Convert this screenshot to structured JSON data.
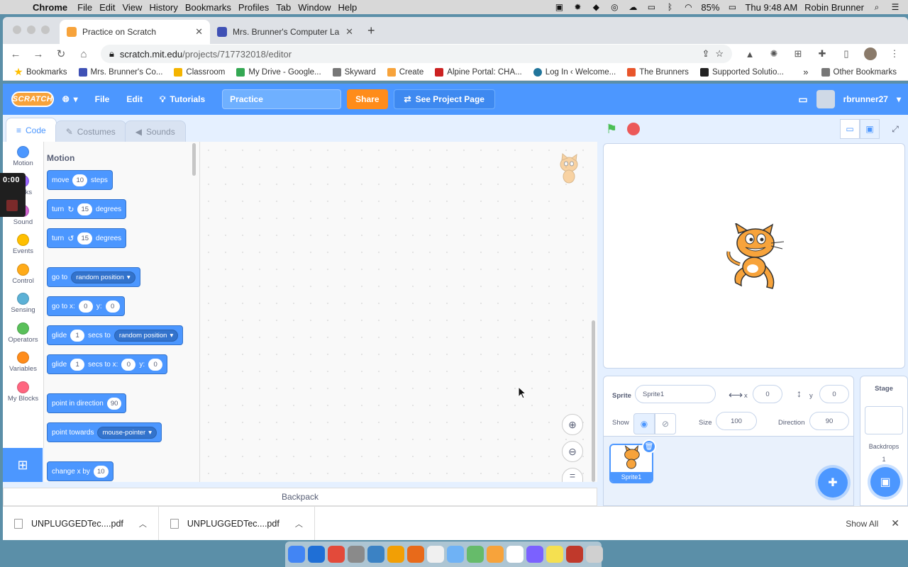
{
  "menubar": {
    "app": "Chrome",
    "items": [
      "File",
      "Edit",
      "View",
      "History",
      "Bookmarks",
      "Profiles",
      "Tab",
      "Window",
      "Help"
    ],
    "battery": "85%",
    "clock": "Thu 9:48 AM",
    "user": "Robin Brunner"
  },
  "tabs": [
    {
      "title": "Practice on Scratch",
      "color": "#f7a33b"
    },
    {
      "title": "Mrs. Brunner's Computer Lab",
      "color": "#3f51b5"
    }
  ],
  "omnibox": {
    "host": "scratch.mit.edu",
    "path": "/projects/717732018/editor"
  },
  "bookmarks": [
    {
      "label": "Bookmarks",
      "color": "#ffffff"
    },
    {
      "label": "Mrs. Brunner's Co...",
      "color": "#3f51b5"
    },
    {
      "label": "Classroom",
      "color": "#f4b400"
    },
    {
      "label": "My Drive - Google...",
      "color": "#34a853"
    },
    {
      "label": "Skyward",
      "color": "#777777"
    },
    {
      "label": "Create",
      "color": "#f7a33b"
    },
    {
      "label": "Alpine Portal: CHA...",
      "color": "#cc2222"
    },
    {
      "label": "Log In ‹ Welcome...",
      "color": "#21759b"
    },
    {
      "label": "The Brunners",
      "color": "#e8552b"
    },
    {
      "label": "Supported Solutio...",
      "color": "#222222"
    }
  ],
  "bookmarks_more": "»",
  "bookmarks_other": "Other Bookmarks",
  "scratch": {
    "logo": "SCRATCH",
    "file": "File",
    "edit": "Edit",
    "tutorials": "Tutorials",
    "project_title": "Practice",
    "share": "Share",
    "see_project": "See Project Page",
    "username": "rbrunner27",
    "tabs": [
      "Code",
      "Costumes",
      "Sounds"
    ],
    "categories": [
      {
        "label": "Motion",
        "color": "#4c97ff"
      },
      {
        "label": "Looks",
        "color": "#9966ff"
      },
      {
        "label": "Sound",
        "color": "#cf63cf"
      },
      {
        "label": "Events",
        "color": "#ffbf00"
      },
      {
        "label": "Control",
        "color": "#ffab19"
      },
      {
        "label": "Sensing",
        "color": "#5cb1d6"
      },
      {
        "label": "Operators",
        "color": "#59c059"
      },
      {
        "label": "Variables",
        "color": "#ff8c1a"
      },
      {
        "label": "My Blocks",
        "color": "#ff6680"
      }
    ],
    "palette_heading": "Motion",
    "blocks": {
      "move": {
        "a": "move",
        "v": "10",
        "b": "steps"
      },
      "turn_right": {
        "a": "turn",
        "v": "15",
        "b": "degrees"
      },
      "turn_left": {
        "a": "turn",
        "v": "15",
        "b": "degrees"
      },
      "goto": {
        "a": "go to",
        "dd": "random position"
      },
      "goto_xy": {
        "a": "go to x:",
        "x": "0",
        "b": "y:",
        "y": "0"
      },
      "glide": {
        "a": "glide",
        "v": "1",
        "b": "secs to",
        "dd": "random position"
      },
      "glide_xy": {
        "a": "glide",
        "v": "1",
        "b": "secs to x:",
        "x": "0",
        "c": "y:",
        "y": "0"
      },
      "point_dir": {
        "a": "point in direction",
        "v": "90"
      },
      "point_towards": {
        "a": "point towards",
        "dd": "mouse-pointer"
      },
      "change_x": {
        "a": "change x by",
        "v": "10"
      }
    },
    "backpack": "Backpack",
    "sprite_info": {
      "sprite_label": "Sprite",
      "sprite_name": "Sprite1",
      "x_label": "x",
      "x": "0",
      "y_label": "y",
      "y": "0",
      "show_label": "Show",
      "size_label": "Size",
      "size": "100",
      "direction_label": "Direction",
      "direction": "90"
    },
    "sprite_thumb": "Sprite1",
    "stage_panel": {
      "title": "Stage",
      "backdrops_label": "Backdrops",
      "backdrops_count": "1"
    }
  },
  "recorder_time": "0:00",
  "downloads": [
    {
      "name": "UNPLUGGEDTec....pdf"
    },
    {
      "name": "UNPLUGGEDTec....pdf"
    }
  ],
  "downloads_show_all": "Show All",
  "dock_colors": [
    "#4285f4",
    "#1f6fd6",
    "#e34a3a",
    "#8a8a8a",
    "#3b82c4",
    "#f29f05",
    "#e86a1a",
    "#f0f0f0",
    "#6fb2f5",
    "#66bb6a",
    "#f7a33b",
    "#ffffff",
    "#7b61ff",
    "#f5e050",
    "#c0392b",
    "#d0d0d0"
  ]
}
